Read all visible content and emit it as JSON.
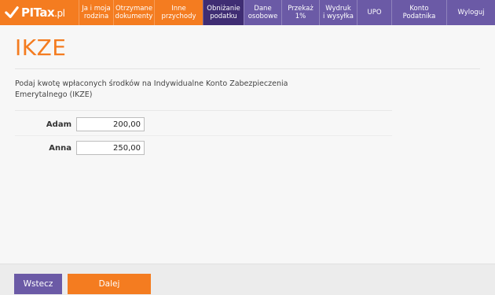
{
  "brand": {
    "name": "PITax",
    "tld": ".pl"
  },
  "nav": [
    {
      "label_1": "Ja i moja",
      "label_2": "rodzina",
      "style": "orange"
    },
    {
      "label_1": "Otrzymane",
      "label_2": "dokumenty",
      "style": "orange"
    },
    {
      "label_1": "Inne",
      "label_2": "przychody",
      "style": "orange"
    },
    {
      "label_1": "Obniżanie",
      "label_2": "podatku",
      "style": "active"
    },
    {
      "label_1": "Dane",
      "label_2": "osobowe",
      "style": "purple"
    },
    {
      "label_1": "Przekaż",
      "label_2": "1%",
      "style": "purple"
    },
    {
      "label_1": "Wydruk",
      "label_2": "i wysyłka",
      "style": "purple"
    },
    {
      "label_1": "UPO",
      "label_2": "",
      "style": "purple"
    },
    {
      "label_1": "Konto",
      "label_2": "Podatnika",
      "style": "purple"
    },
    {
      "label_1": "Wyloguj",
      "label_2": "",
      "style": "purple"
    }
  ],
  "page": {
    "title": "IKZE",
    "description": "Podaj kwotę wpłaconych środków na Indywidualne Konto Zabezpieczenia Emerytalnego (IKZE)"
  },
  "form": {
    "adam_label": "Adam",
    "adam_value": "200,00",
    "anna_label": "Anna",
    "anna_value": "250,00"
  },
  "footer": {
    "back_label": "Wstecz",
    "next_label": "Dalej"
  },
  "colors": {
    "orange": "#f47c20",
    "purple": "#6b5aa6",
    "active": "#3f2d73"
  }
}
